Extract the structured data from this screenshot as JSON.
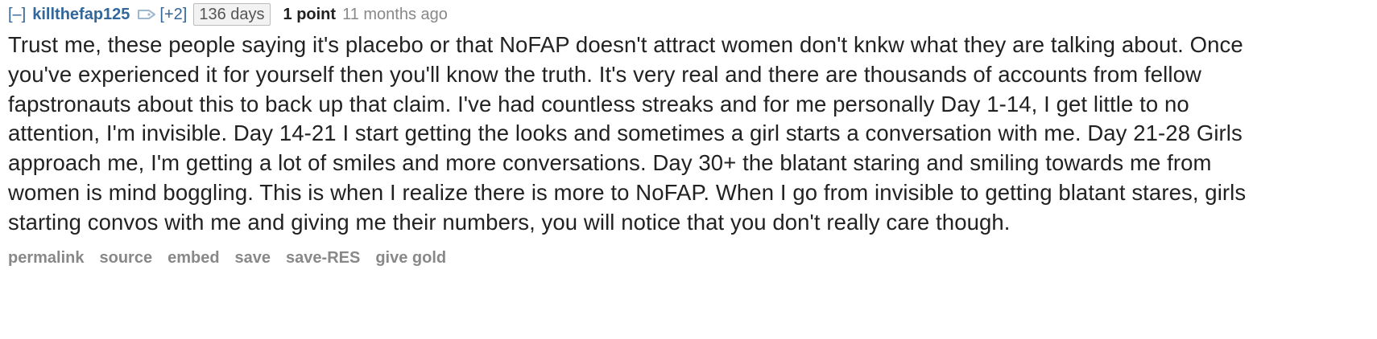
{
  "comment": {
    "expand_label": "[–]",
    "author": "killthefap125",
    "icon": "tag-icon",
    "karma_label": "[+2]",
    "days_badge": "136 days",
    "score": "1 point",
    "time": "11 months ago",
    "body": "Trust me, these people saying it's placebo or that NoFAP doesn't attract women don't knkw what they are talking about. Once you've experienced it for yourself then you'll know the truth. It's very real and there are thousands of accounts from fellow fapstronauts about this to back up that claim. I've had countless streaks and for me personally Day 1-14, I get little to no attention, I'm invisible. Day 14-21 I start getting the looks and sometimes a girl starts a conversation with me. Day 21-28 Girls approach me, I'm getting a lot of smiles and more conversations. Day 30+ the blatant staring and smiling towards me from women is mind boggling. This is when I realize there is more to NoFAP. When I go from invisible to getting blatant stares, girls starting convos with me and giving me their numbers, you will notice that you don't really care though."
  },
  "buttons": {
    "permalink": "permalink",
    "source": "source",
    "embed": "embed",
    "save": "save",
    "save_res": "save-RES",
    "give_gold": "give gold"
  },
  "colors": {
    "author": "#336699",
    "meta": "#888888",
    "text": "#222222",
    "badge_bg": "#f2f2f2"
  }
}
